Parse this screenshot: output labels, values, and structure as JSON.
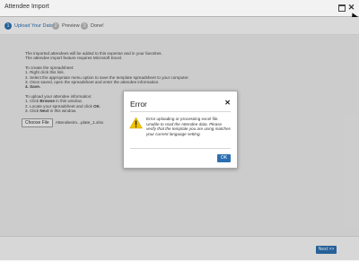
{
  "window": {
    "title": "Attendee Import",
    "maximize_icon": "maximize-icon",
    "close_icon": "close-icon",
    "close_glyph": "✕"
  },
  "steps": [
    {
      "number": "1",
      "label": "Upload Your Data",
      "active": true
    },
    {
      "number": "2",
      "label": "Preview",
      "active": false
    },
    {
      "number": "3",
      "label": "Done!",
      "active": false
    }
  ],
  "instructions": {
    "intro_1": "The imported attendees will be added to this expense and in your favorites.",
    "intro_2": "The attendee import feature requires Microsoft Excel.",
    "create_heading": "To create the spreadsheet:",
    "create_1": "1. Right click this link.",
    "create_2": "2. Select the appropriate menu option to save the template spreadsheet to your computer.",
    "create_3": "3. Once saved, open the spreadsheet and enter the attendee information.",
    "create_4": "4. Save.",
    "upload_heading": "To upload your attendee information:",
    "upload_1_pre": "1. Click ",
    "upload_1_bold": "Browse",
    "upload_1_post": " in this window.",
    "upload_2_pre": "2. Locate your spreadsheet and click ",
    "upload_2_bold": "OK",
    "upload_2_post": ".",
    "upload_3_pre": "3. Click ",
    "upload_3_bold": "Next",
    "upload_3_post": " in this window."
  },
  "file": {
    "choose_label": "Choose File",
    "file_name": "Attendeeim...plate_1.xlsx"
  },
  "footer": {
    "next_label": "Next >>"
  },
  "dialog": {
    "title": "Error",
    "close_glyph": "✕",
    "icon": "warning-icon",
    "message_1": "Error uploading or processing excel file.",
    "message_2": "Unable to read the Attendee data. Please verify that the template you are using matches your current language setting.",
    "ok_label": "OK"
  },
  "colors": {
    "accent": "#2c6fb0",
    "warning": "#f2c200"
  }
}
